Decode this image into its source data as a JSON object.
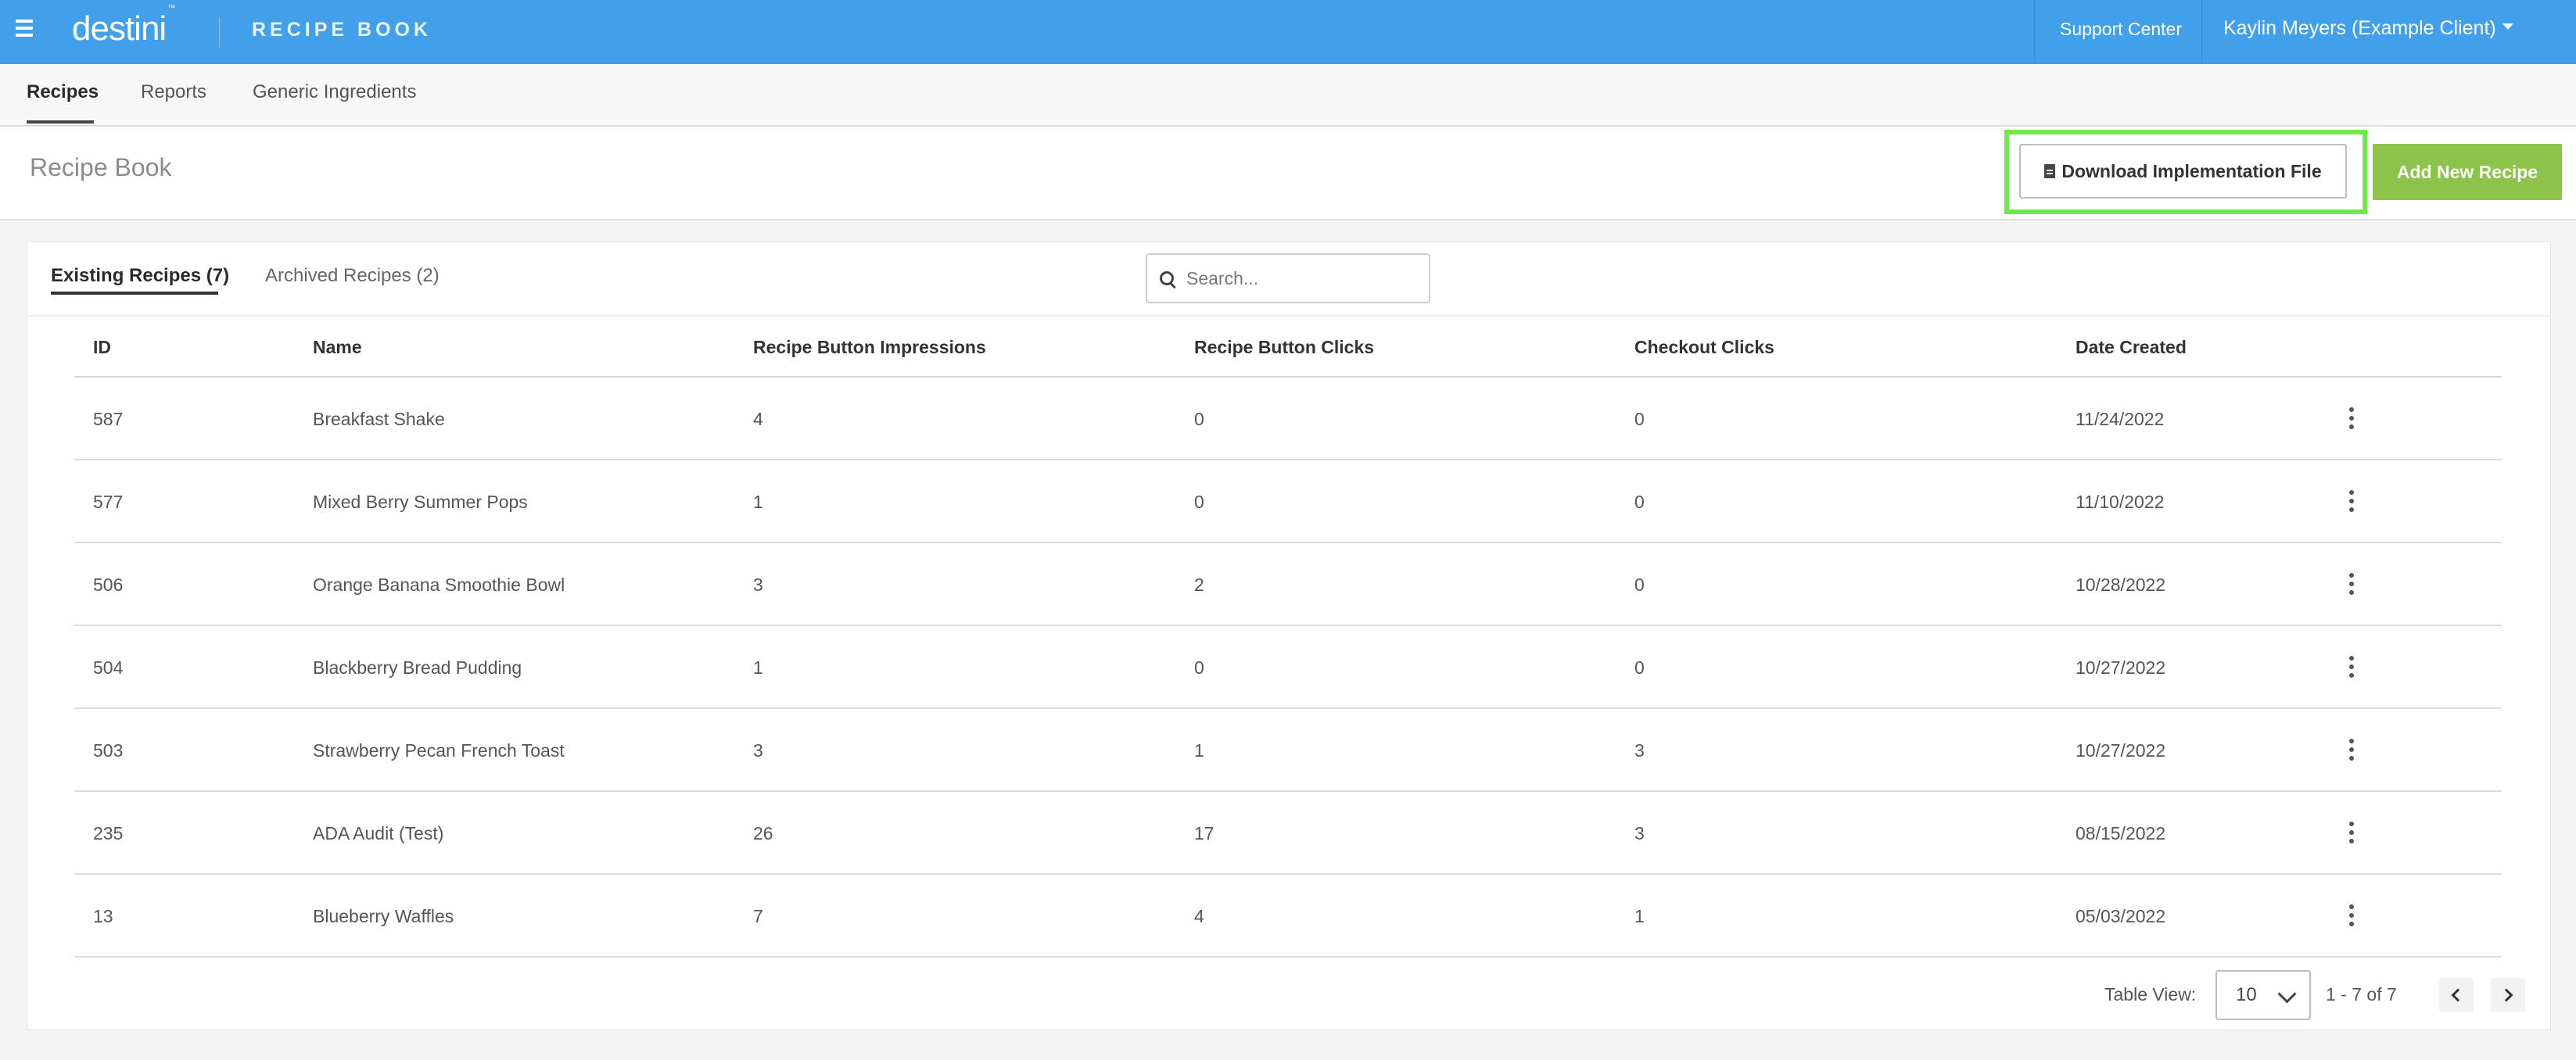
{
  "topbar": {
    "logo": "destini",
    "logo_tm": "™",
    "app_title": "RECIPE BOOK",
    "support": "Support Center",
    "user": "Kaylin Meyers (Example Client)"
  },
  "subnav": {
    "tabs": [
      "Recipes",
      "Reports",
      "Generic Ingredients"
    ],
    "active": "Recipes"
  },
  "page": {
    "title": "Recipe Book",
    "download_button": "Download Implementation File",
    "add_button": "Add New Recipe"
  },
  "card": {
    "tabs": [
      "Existing Recipes (7)",
      "Archived Recipes (2)"
    ],
    "active_tab": "Existing Recipes (7)",
    "search_placeholder": "Search..."
  },
  "table": {
    "columns": [
      "ID",
      "Name",
      "Recipe Button Impressions",
      "Recipe Button Clicks",
      "Checkout Clicks",
      "Date Created"
    ],
    "rows": [
      [
        "587",
        "Breakfast Shake",
        "4",
        "0",
        "0",
        "11/24/2022"
      ],
      [
        "577",
        "Mixed Berry Summer Pops",
        "1",
        "0",
        "0",
        "11/10/2022"
      ],
      [
        "506",
        "Orange Banana Smoothie Bowl",
        "3",
        "2",
        "0",
        "10/28/2022"
      ],
      [
        "504",
        "Blackberry Bread Pudding",
        "1",
        "0",
        "0",
        "10/27/2022"
      ],
      [
        "503",
        "Strawberry Pecan French Toast",
        "3",
        "1",
        "3",
        "10/27/2022"
      ],
      [
        "235",
        "ADA Audit (Test)",
        "26",
        "17",
        "3",
        "08/15/2022"
      ],
      [
        "13",
        "Blueberry Waffles",
        "7",
        "4",
        "1",
        "05/03/2022"
      ]
    ]
  },
  "footer": {
    "table_view_label": "Table View:",
    "table_view_value": "10",
    "page_info": "1 - 7 of 7"
  },
  "colors": {
    "topbar": "#42a0ea",
    "add_button": "#8dc34a",
    "highlight": "#6fe84a"
  }
}
